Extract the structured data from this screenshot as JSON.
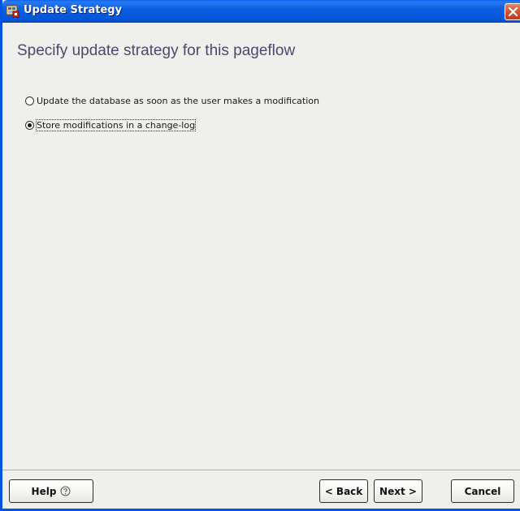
{
  "window": {
    "title": "Update Strategy",
    "icon": "pageflow-wizard-icon",
    "close_icon": "close-icon",
    "accent": "#0054e3"
  },
  "main": {
    "heading": "Specify update strategy for this pageflow",
    "options": [
      {
        "label": "Update the database as soon as the user makes a modification",
        "selected": false
      },
      {
        "label": "Store modifications in a change-log",
        "selected": true
      }
    ]
  },
  "footer": {
    "help_label": "Help",
    "help_icon": "help-circle-icon",
    "back_label": "< Back",
    "next_label": "Next >",
    "cancel_label": "Cancel"
  }
}
